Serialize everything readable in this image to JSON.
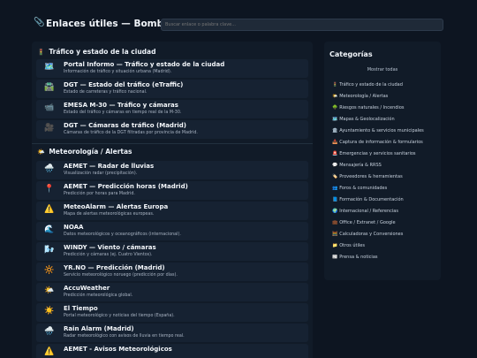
{
  "header": {
    "title_icon": "paperclip-icon",
    "title": "Enlaces útiles — Bomberos",
    "search_placeholder": "Buscar enlace o palabra clave..."
  },
  "sections": [
    {
      "icon": "traffic-light-icon",
      "icon_glyph": "🚦",
      "title": "Tráfico y estado de la ciudad",
      "links": [
        {
          "icon": "map-icon",
          "glyph": "🗺️",
          "name": "Portal Informo — Tráfico y estado de la ciudad",
          "desc": "Información de tráfico y situación urbana (Madrid)."
        },
        {
          "icon": "motorway-icon",
          "glyph": "🛣️",
          "name": "DGT — Estado del tráfico (eTraffic)",
          "desc": "Estado de carreteras y tráfico nacional."
        },
        {
          "icon": "video-camera-icon",
          "glyph": "📹",
          "name": "EMESA M-30 — Tráfico y cámaras",
          "desc": "Estado del tráfico y cámaras en tiempo real de la M-30."
        },
        {
          "icon": "camera-icon",
          "glyph": "🎥",
          "name": "DGT — Cámaras de tráfico (Madrid)",
          "desc": "Cámaras de tráfico de la DGT filtradas por provincia de Madrid."
        }
      ]
    },
    {
      "icon": "weather-icon",
      "icon_glyph": "🌤️",
      "title": "Meteorología / Alertas",
      "links": [
        {
          "icon": "rain-cloud-icon",
          "glyph": "🌧️",
          "name": "AEMET — Radar de lluvias",
          "desc": "Visualización radar (precipitación)."
        },
        {
          "icon": "pin-icon",
          "glyph": "📍",
          "name": "AEMET — Predicción horas (Madrid)",
          "desc": "Predicción por horas para Madrid."
        },
        {
          "icon": "warning-icon",
          "glyph": "⚠️",
          "name": "MeteoAlarm — Alertas Europa",
          "desc": "Mapa de alertas meteorológicas europeas."
        },
        {
          "icon": "wave-icon",
          "glyph": "🌊",
          "name": "NOAA",
          "desc": "Datos meteorológicos y oceanográficos (internacional)."
        },
        {
          "icon": "wind-icon",
          "glyph": "🌬️",
          "name": "WINDY — Viento / cámaras",
          "desc": "Predicción y cámaras (ej. Cuatro Vientos)."
        },
        {
          "icon": "sun-icon",
          "glyph": "🔆",
          "name": "YR.NO — Predicción (Madrid)",
          "desc": "Servicio meteorológico noruego (predicción por días)."
        },
        {
          "icon": "sun-cloud-icon",
          "glyph": "🌤️",
          "name": "AccuWeather",
          "desc": "Predicción meteorológica global."
        },
        {
          "icon": "sun-icon",
          "glyph": "☀️",
          "name": "El Tiempo",
          "desc": "Portal meteorológico y noticias del tiempo (España)."
        },
        {
          "icon": "rain-cloud-icon",
          "glyph": "🌧️",
          "name": "Rain Alarm (Madrid)",
          "desc": "Radar meteorológico con avisos de lluvia en tiempo real."
        },
        {
          "icon": "warning-icon",
          "glyph": "⚠️",
          "name": "AEMET - Avisos Meteorológicos",
          "desc": ""
        }
      ]
    }
  ],
  "sidebar": {
    "title": "Categorías",
    "all_label": "Mostrar todas",
    "categories": [
      {
        "icon": "traffic-light-icon",
        "glyph": "🚦",
        "label": "Tráfico y estado de la ciudad"
      },
      {
        "icon": "weather-icon",
        "glyph": "🌤️",
        "label": "Meteorología / Alertas"
      },
      {
        "icon": "tree-icon",
        "glyph": "🌳",
        "label": "Riesgos naturales / Incendios"
      },
      {
        "icon": "map-icon",
        "glyph": "🗺️",
        "label": "Mapas & Geolocalización"
      },
      {
        "icon": "building-icon",
        "glyph": "🏛️",
        "label": "Ayuntamiento & servicios municipales"
      },
      {
        "icon": "inbox-icon",
        "glyph": "📥",
        "label": "Captura de información & formularios"
      },
      {
        "icon": "siren-icon",
        "glyph": "🚨",
        "label": "Emergencias y servicios sanitarios"
      },
      {
        "icon": "chat-icon",
        "glyph": "💬",
        "label": "Mensajería & RRSS"
      },
      {
        "icon": "tag-icon",
        "glyph": "🏷️",
        "label": "Proveedores & herramientas"
      },
      {
        "icon": "people-icon",
        "glyph": "👥",
        "label": "Foros & comunidades"
      },
      {
        "icon": "book-icon",
        "glyph": "📘",
        "label": "Formación & Documentación"
      },
      {
        "icon": "globe-icon",
        "glyph": "🌍",
        "label": "Internacional / Referencias"
      },
      {
        "icon": "briefcase-icon",
        "glyph": "💼",
        "label": "Office / Extranet / Google"
      },
      {
        "icon": "calculator-icon",
        "glyph": "🧮",
        "label": "Calculadoras y Conversiones"
      },
      {
        "icon": "folder-icon",
        "glyph": "📁",
        "label": "Otros útiles"
      },
      {
        "icon": "newspaper-icon",
        "glyph": "📰",
        "label": "Prensa & noticias"
      }
    ]
  },
  "colors": {
    "background": "#0d1521",
    "panel": "#111b28",
    "card": "#162232",
    "text": "#e6edf6",
    "muted": "#a8b3c2"
  }
}
